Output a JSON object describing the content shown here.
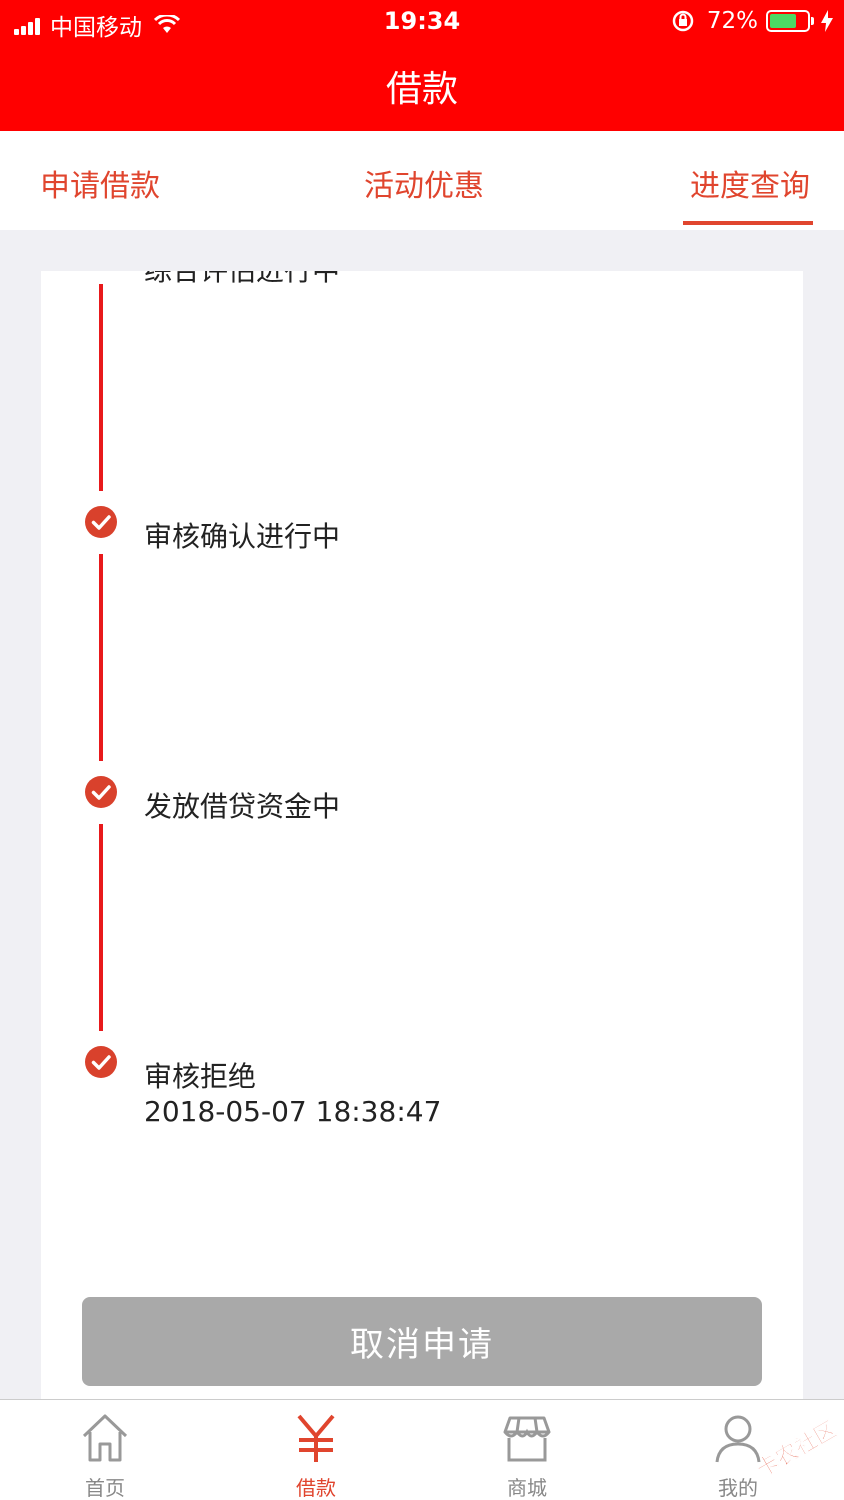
{
  "status_bar": {
    "carrier": "中国移动",
    "time": "19:34",
    "battery_percent": "72%",
    "battery_level": 0.72
  },
  "header": {
    "title": "借款"
  },
  "tabs": [
    {
      "label": "申请借款",
      "active": false
    },
    {
      "label": "活动优惠",
      "active": false
    },
    {
      "label": "进度查询",
      "active": true
    }
  ],
  "progress": {
    "cut_step_label": "综合评估进行中",
    "steps": [
      {
        "label": "审核确认进行中",
        "time": ""
      },
      {
        "label": "发放借贷资金中",
        "time": ""
      },
      {
        "label": "审核拒绝",
        "time": "2018-05-07 18:38:47"
      }
    ]
  },
  "cancel_button": {
    "label": "取消申请"
  },
  "tabbar": [
    {
      "label": "首页",
      "icon": "home-icon",
      "active": false
    },
    {
      "label": "借款",
      "icon": "yen-icon",
      "active": true
    },
    {
      "label": "商城",
      "icon": "store-icon",
      "active": false
    },
    {
      "label": "我的",
      "icon": "user-icon",
      "active": false
    }
  ],
  "watermark": {
    "text": "卡农社区"
  },
  "colors": {
    "header_bg": "#ff0000",
    "accent": "#e0452e",
    "timeline": "#e8191b",
    "button_disabled": "#a9a9a9"
  }
}
